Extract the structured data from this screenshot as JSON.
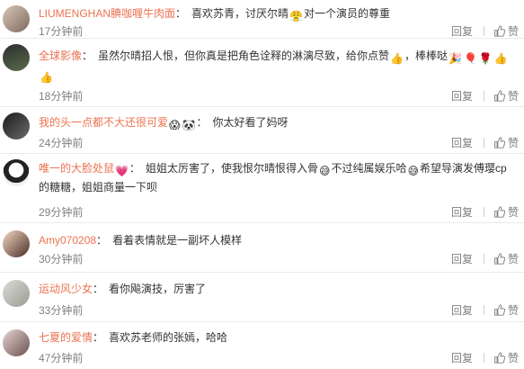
{
  "comments": [
    {
      "user": "LIUMENGHAN腆咖喱牛肉面",
      "text_a": "喜欢苏青，讨厌尔晴",
      "text_b": "对一个演员的尊重",
      "text_c": "",
      "time": "17分钟前",
      "reply": "回复",
      "like": "赞"
    },
    {
      "user": "全球影像",
      "text_a": "虽然尔晴招人恨，但你真是把角色诠释的淋漓尽致，给你点赞",
      "text_b": "，棒棒哒",
      "text_c": "",
      "time": "18分钟前",
      "reply": "回复",
      "like": "赞"
    },
    {
      "user": "我的头一点都不大还很可爱",
      "text_a": "你太好看了妈呀",
      "text_b": "",
      "text_c": "",
      "time": "24分钟前",
      "reply": "回复",
      "like": "赞"
    },
    {
      "user": "唯一的大脸处鼠",
      "text_a": "姐姐太厉害了，使我恨尔晴恨得入骨",
      "text_b": "不过纯属娱乐哈",
      "text_c": "希望导演发傅璎cp的糖糖，姐姐商量一下呗",
      "time": "29分钟前",
      "reply": "回复",
      "like": "赞"
    },
    {
      "user": "Amy070208",
      "text_a": "看着表情就是一副坏人模样",
      "text_b": "",
      "text_c": "",
      "time": "30分钟前",
      "reply": "回复",
      "like": "赞"
    },
    {
      "user": "运动风少女",
      "text_a": "看你飚演技，厉害了",
      "text_b": "",
      "text_c": "",
      "time": "33分钟前",
      "reply": "回复",
      "like": "赞"
    },
    {
      "user": "七夏的爱情",
      "text_a": "喜欢苏老师的张嫣，哈哈",
      "text_b": "",
      "text_c": "",
      "time": "47分钟前",
      "reply": "回复",
      "like": "赞"
    }
  ],
  "emoji": {
    "thumb": "👍",
    "rose": "🌹",
    "balloon": "🎈",
    "heart": "💗",
    "panda": "🐼",
    "sweat": "😅",
    "rage": "😤",
    "wow": "😱",
    "party": "🎉"
  },
  "colors": {
    "username": "#eb7350",
    "text": "#333333",
    "meta": "#808080"
  }
}
